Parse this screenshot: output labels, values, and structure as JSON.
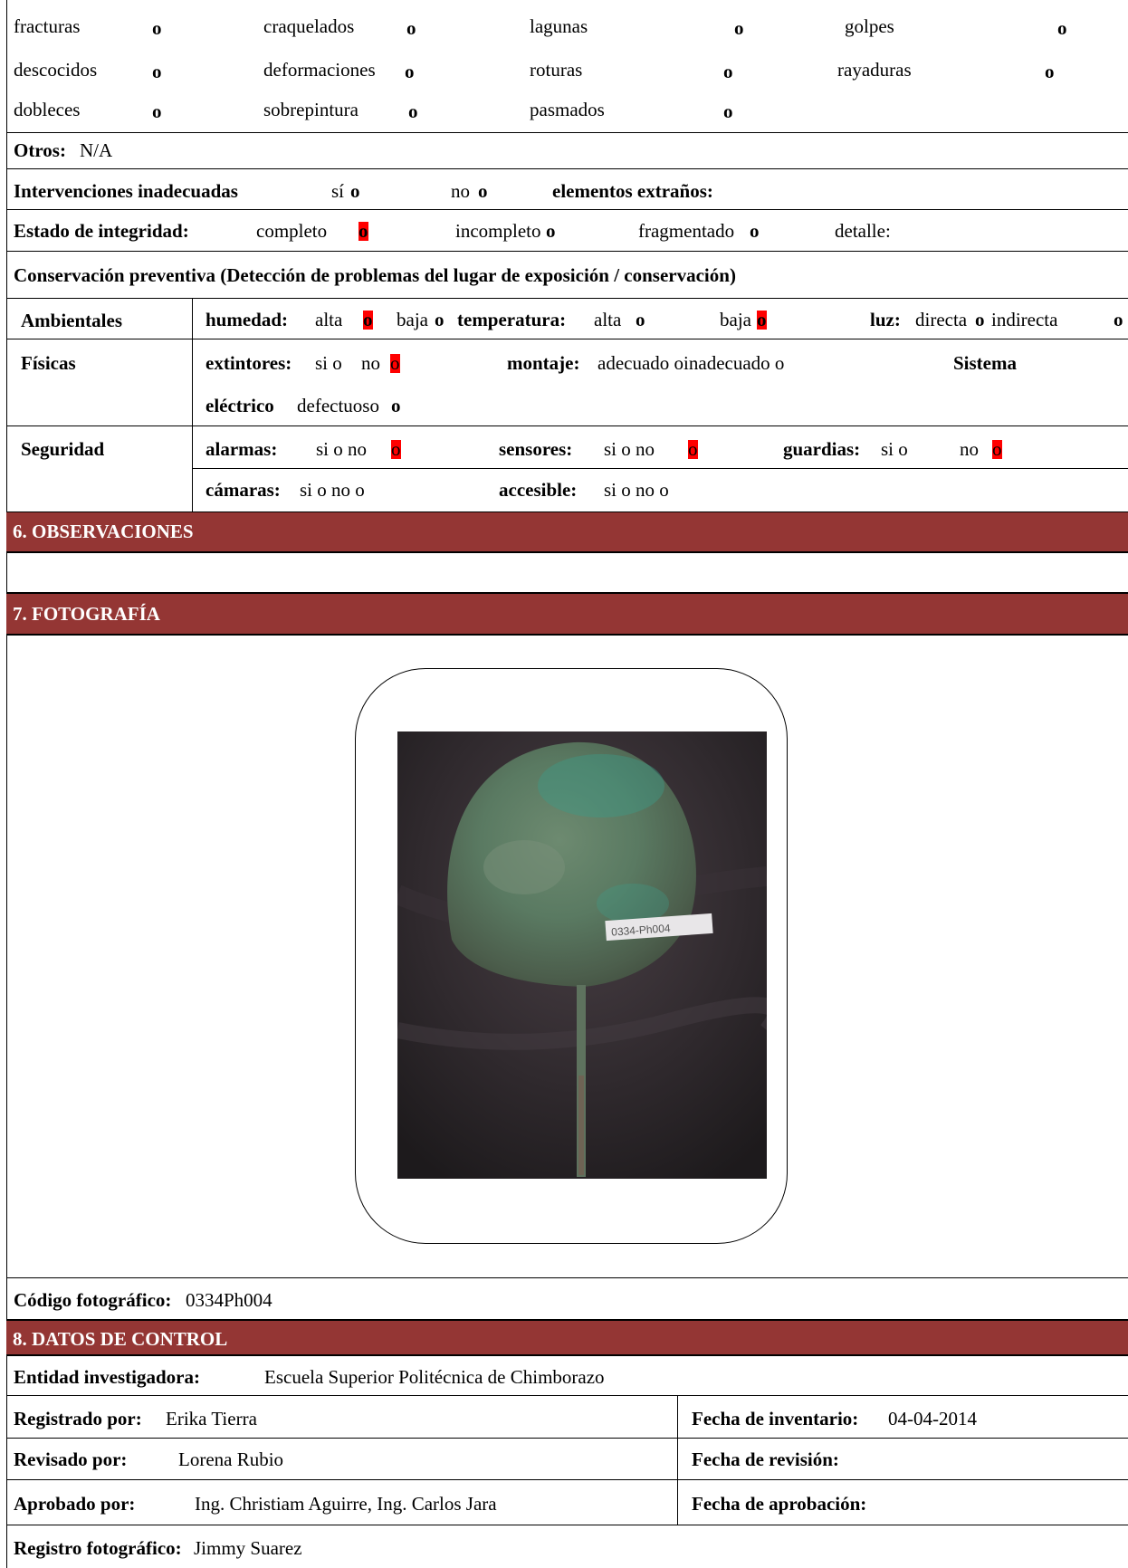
{
  "damage_rows": [
    [
      "fracturas",
      "o",
      "craquelados",
      "o",
      "lagunas",
      "o",
      "golpes",
      "o"
    ],
    [
      "descocidos",
      "o",
      "deformaciones",
      "o",
      "roturas",
      "o",
      "rayaduras",
      "o"
    ],
    [
      "dobleces",
      "o",
      "sobrepintura",
      "o",
      "pasmados",
      "o"
    ]
  ],
  "otros": {
    "label": "Otros:",
    "value": "N/A"
  },
  "intervenciones": {
    "label": "Intervenciones inadecuadas",
    "si": "sí",
    "o1": "o",
    "no": "no",
    "o2": "o",
    "extranos": "elementos extraños:"
  },
  "integridad": {
    "label": "Estado de integridad:",
    "completo": "completo",
    "completo_mark": "o",
    "incompleto": "incompleto",
    "incompleto_mark": "o",
    "fragmentado": "fragmentado",
    "fragmentado_mark": "o",
    "detalle": "detalle:"
  },
  "conservacion_title": "Conservación preventiva (Detección de problemas del lugar de exposición / conservación)",
  "ambientales": {
    "label": "Ambientales",
    "humedad": "humedad:",
    "alta": "alta",
    "alta_mark": "o",
    "baja": "baja",
    "baja_mark": "o",
    "temperatura": "temperatura:",
    "t_alta": "alta",
    "t_alta_mark": "o",
    "t_baja": "baja",
    "t_baja_mark": "o",
    "luz": "luz:",
    "directa": "directa",
    "directa_mark": "o",
    "indirecta": "indirecta",
    "indirecta_mark": "o"
  },
  "fisicas": {
    "label": "Físicas",
    "extintores": "extintores:",
    "ext_si": "si o",
    "ext_no": "no",
    "ext_no_mark": "o",
    "montaje": "montaje:",
    "montaje_vals": "adecuado oinadecuado o",
    "sistema": "Sistema",
    "electrico": "eléctrico",
    "defectuoso": "defectuoso",
    "def_mark": "o"
  },
  "seguridad": {
    "label": "Seguridad",
    "alarmas": "alarmas:",
    "al_vals": "si o no",
    "al_mark": "o",
    "sensores": "sensores:",
    "sen_vals": "si o  no",
    "sen_mark": "o",
    "guardias": "guardias:",
    "gu_vals": "si o",
    "gu_no": "no",
    "gu_mark": "o",
    "camaras": "cámaras:",
    "cam_vals": "si o no  o",
    "accesible": "accesible:",
    "acc_vals": "si  o  no o"
  },
  "sections": {
    "observaciones": "6. OBSERVACIONES",
    "fotografia": "7. FOTOGRAFÍA",
    "control": "8. DATOS DE CONTROL"
  },
  "photo_tag": "0334-Ph004",
  "codigo": {
    "label": "Código fotográfico:",
    "value": "0334Ph004"
  },
  "control": {
    "entidad_label": "Entidad investigadora:",
    "entidad": "Escuela Superior Politécnica de Chimborazo",
    "registrado_label": "Registrado por:",
    "registrado": "Erika Tierra",
    "fecha_inv_label": "Fecha de inventario:",
    "fecha_inv": "04-04-2014",
    "revisado_label": "Revisado por:",
    "revisado": "Lorena Rubio",
    "fecha_rev_label": "Fecha de revisión:",
    "aprobado_label": "Aprobado por:",
    "aprobado": "Ing. Christiam Aguirre, Ing. Carlos Jara",
    "fecha_apr_label": "Fecha de aprobación:",
    "registro_label": "Registro fotográfico:",
    "registro": "Jimmy Suarez"
  },
  "colors": {
    "section_bg": "#943634",
    "mark_highlight": "#ff0000"
  }
}
